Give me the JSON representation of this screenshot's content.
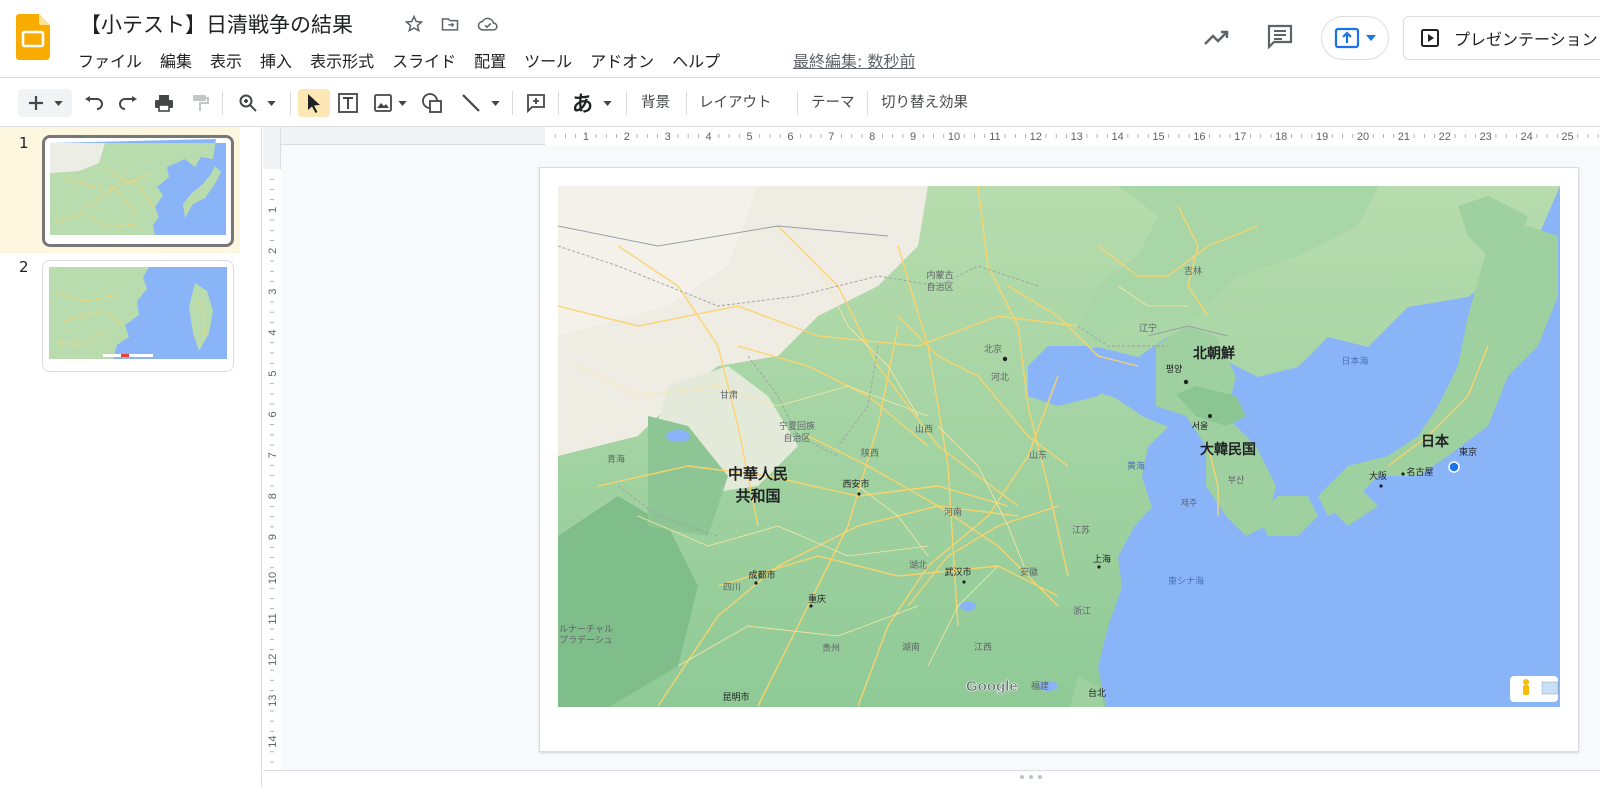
{
  "header": {
    "title": "【小テスト】日清戦争の結果",
    "last_edit": "最終編集: 数秒前",
    "present_label": "プレゼンテーション"
  },
  "menu": [
    "ファイル",
    "編集",
    "表示",
    "挿入",
    "表示形式",
    "スライド",
    "配置",
    "ツール",
    "アドオン",
    "ヘルプ"
  ],
  "toolbar": {
    "background": "背景",
    "layout": "レイアウト",
    "theme": "テーマ",
    "transition": "切り替え効果",
    "text_style": "あ"
  },
  "slides": [
    {
      "number": "1",
      "selected": true
    },
    {
      "number": "2",
      "selected": false
    }
  ],
  "ruler": {
    "h": [
      "1",
      "2",
      "3",
      "4",
      "5",
      "6",
      "7",
      "8",
      "9",
      "10",
      "11",
      "12",
      "13",
      "14",
      "15",
      "16",
      "17",
      "18",
      "19",
      "20",
      "21",
      "22",
      "23",
      "24",
      "25"
    ],
    "v": [
      "1",
      "2",
      "3",
      "4",
      "5",
      "6",
      "7",
      "8",
      "9",
      "10",
      "11",
      "12",
      "13",
      "14"
    ]
  },
  "map_labels": {
    "inner_mongolia": [
      "内蒙古",
      "自治区"
    ],
    "beijing": "北京",
    "hebei": "河北",
    "liaoning": "辽宁",
    "jilin": "吉林",
    "north_korea": "北朝鮮",
    "pyongyang": "평양",
    "seoul": "서울",
    "south_korea": "大韓民国",
    "busan": "부산",
    "jeju": "제주",
    "sea_of_japan": "日本海",
    "japan": "日本",
    "tokyo": "東京",
    "osaka": "大阪",
    "nagoya": "名古屋",
    "yellow_sea": "黄海",
    "east_china_sea": "東シナ海",
    "gansu": "甘肃",
    "ningxia": [
      "宁夏回族",
      "自治区"
    ],
    "shanxi": "山西",
    "qinghai": "青海",
    "prc": [
      "中華人民",
      "共和国"
    ],
    "xian": "西安市",
    "shaanxi": "陕西",
    "shandong": "山东",
    "henan": "河南",
    "jiangsu": "江苏",
    "shanghai": "上海",
    "chengdu": "成都市",
    "sichuan": "四川",
    "hubei": "湖北",
    "wuhan": "武汉市",
    "anhui": "安徽",
    "chongqing": "重庆",
    "zhejiang": "浙江",
    "tibet": [
      "ルナーチャル",
      "プラデーシュ"
    ],
    "guizhou": "贵州",
    "hunan": "湖南",
    "jiangxi": "江西",
    "kunming": "昆明市",
    "fujian": "福建",
    "taipei": "台北",
    "google": "Google"
  },
  "icons": [
    "slides-logo-icon",
    "star-icon",
    "move-folder-icon",
    "cloud-saved-icon",
    "activity-trend-icon",
    "comment-icon",
    "share-upload-icon",
    "present-icon",
    "add-icon",
    "undo-icon",
    "redo-icon",
    "print-icon",
    "paint-format-icon",
    "zoom-icon",
    "cursor-icon",
    "textbox-icon",
    "image-icon",
    "shape-icon",
    "line-icon",
    "add-comment-icon",
    "pegman-icon"
  ],
  "colors": {
    "accent": "#1a73e8",
    "selected_slide_bg": "#fef7e0",
    "logo": "#f9ab00",
    "land": "#a8d5a2",
    "water": "#8ab4f8",
    "road": "#fdd36b"
  }
}
